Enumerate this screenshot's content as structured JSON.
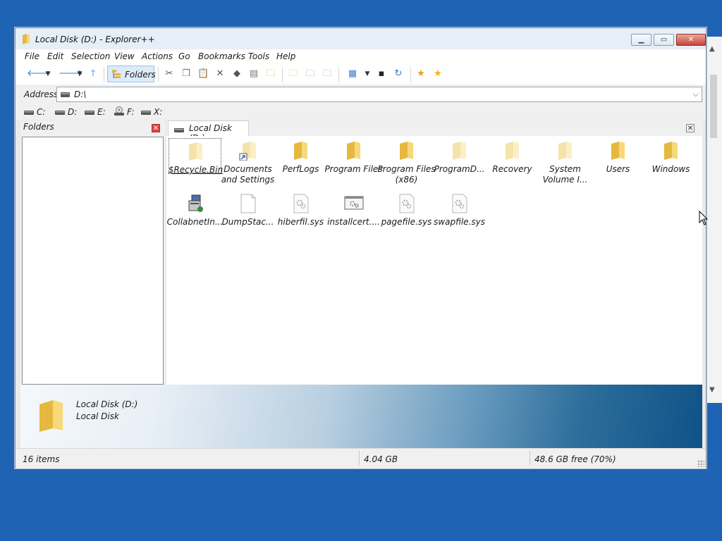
{
  "window": {
    "title": "Local Disk (D:) - Explorer++"
  },
  "menu": [
    "File",
    "Edit",
    "Selection",
    "View",
    "Actions",
    "Go",
    "Bookmarks",
    "Tools",
    "Help"
  ],
  "toolbar": {
    "folders_label": "Folders"
  },
  "address": {
    "label": "Address",
    "value": "D:\\"
  },
  "drives": [
    "C:",
    "D:",
    "E:",
    "F:",
    "X:"
  ],
  "folders_pane": {
    "title": "Folders"
  },
  "tab": {
    "label": "Local Disk (D:)"
  },
  "files": [
    {
      "name": "$Recycle.Bin",
      "type": "folder-faded",
      "selected": true
    },
    {
      "name": "Documents and Settings",
      "type": "folder-shortcut"
    },
    {
      "name": "PerfLogs",
      "type": "folder"
    },
    {
      "name": "Program Files",
      "type": "folder"
    },
    {
      "name": "Program Files (x86)",
      "type": "folder"
    },
    {
      "name": "ProgramD...",
      "type": "folder-faded"
    },
    {
      "name": "Recovery",
      "type": "folder-faded"
    },
    {
      "name": "System Volume I...",
      "type": "folder-faded"
    },
    {
      "name": "Users",
      "type": "folder"
    },
    {
      "name": "Windows",
      "type": "folder"
    },
    {
      "name": "CollabnetIn...",
      "type": "exe"
    },
    {
      "name": "DumpStac...",
      "type": "file"
    },
    {
      "name": "hiberfil.sys",
      "type": "sys"
    },
    {
      "name": "installcert....",
      "type": "window-file"
    },
    {
      "name": "pagefile.sys",
      "type": "sys"
    },
    {
      "name": "swapfile.sys",
      "type": "sys"
    }
  ],
  "info": {
    "line1": "Local Disk (D:)",
    "line2": "Local Disk"
  },
  "status": {
    "items": "16 items",
    "size": "4.04 GB",
    "free": "48.6 GB free (70%)"
  }
}
